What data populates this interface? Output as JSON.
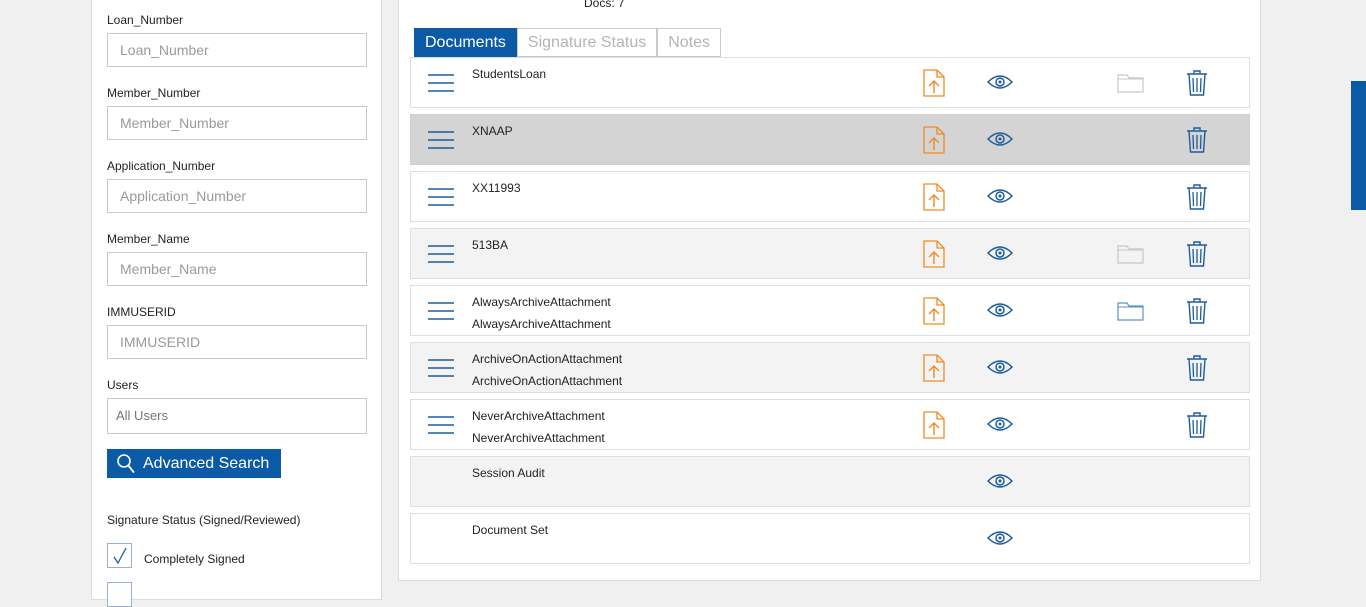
{
  "search": {
    "fields": [
      {
        "label": "Loan_Number",
        "placeholder": "Loan_Number"
      },
      {
        "label": "Member_Number",
        "placeholder": "Member_Number"
      },
      {
        "label": "Application_Number",
        "placeholder": "Application_Number"
      },
      {
        "label": "Member_Name",
        "placeholder": "Member_Name"
      },
      {
        "label": "IMMUSERID",
        "placeholder": "IMMUSERID"
      }
    ],
    "users_label": "Users",
    "users_value": "All Users",
    "advanced_search_label": "Advanced Search",
    "signature_status_title": "Signature Status (Signed/Reviewed)",
    "checkbox_completely_signed": "Completely Signed"
  },
  "main": {
    "docs_count": "Docs: 7",
    "tabs": [
      {
        "label": "Documents",
        "active": true
      },
      {
        "label": "Signature Status",
        "active": false
      },
      {
        "label": "Notes",
        "active": false
      }
    ],
    "rows": [
      {
        "line1": "StudentsLoan",
        "line2": ""
      },
      {
        "line1": "XNAAP",
        "line2": ""
      },
      {
        "line1": "XX11993",
        "line2": ""
      },
      {
        "line1": "513BA",
        "line2": ""
      },
      {
        "line1": "AlwaysArchiveAttachment",
        "line2": "AlwaysArchiveAttachment"
      },
      {
        "line1": "ArchiveOnActionAttachment",
        "line2": "ArchiveOnActionAttachment"
      },
      {
        "line1": "NeverArchiveAttachment",
        "line2": "NeverArchiveAttachment"
      },
      {
        "line1": "Session Audit",
        "line2": ""
      },
      {
        "line1": "Document Set",
        "line2": ""
      }
    ]
  },
  "colors": {
    "primary": "#0b5aa6",
    "upload_orange": "#f08a24",
    "eye_blue": "#1d5d9b",
    "folder_gray": "#c8c8c8",
    "folder_blue": "#5a93c9",
    "selected_row": "#d4d4d4"
  },
  "icons": [
    "menu-icon",
    "upload-icon",
    "eye-icon",
    "folder-icon",
    "trash-icon",
    "search-icon",
    "checkmark-icon"
  ]
}
